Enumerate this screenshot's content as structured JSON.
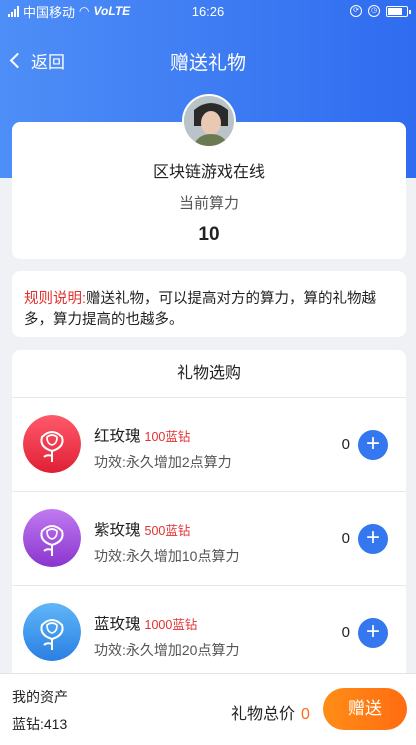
{
  "status_bar": {
    "carrier": "中国移动",
    "network": "VoLTE",
    "time": "16:26"
  },
  "nav": {
    "back_label": "返回",
    "title": "赠送礼物"
  },
  "profile": {
    "name": "区块链游戏在线",
    "power_label": "当前算力",
    "power_value": "10"
  },
  "rule": {
    "tag": "规则说明:",
    "text": "赠送礼物，可以提高对方的算力，算的礼物越多，算力提高的也越多。"
  },
  "shop": {
    "title": "礼物选购",
    "gifts": [
      {
        "name": "红玫瑰",
        "price": "100蓝钻",
        "effect": "功效:永久增加2点算力",
        "qty": "0",
        "color": "#e8253b"
      },
      {
        "name": "紫玫瑰",
        "price": "500蓝钻",
        "effect": "功效:永久增加10点算力",
        "qty": "0",
        "color": "#9b46d6"
      },
      {
        "name": "蓝玫瑰",
        "price": "1000蓝钻",
        "effect": "功效:永久增加20点算力",
        "qty": "0",
        "color": "#2f8ee8"
      }
    ]
  },
  "footer": {
    "assets_label": "我的资产",
    "assets_value": "蓝钻:413",
    "total_label": "礼物总价",
    "total_value": "0",
    "send_label": "赠送"
  },
  "colors": {
    "primary": "#3d7bf3",
    "accent": "#ff6c12",
    "price": "#e3302f"
  },
  "icons": [
    "signal-icon",
    "wifi-icon",
    "battery-icon",
    "alarm-icon",
    "back-chevron-icon",
    "rose-icon",
    "plus-icon"
  ]
}
